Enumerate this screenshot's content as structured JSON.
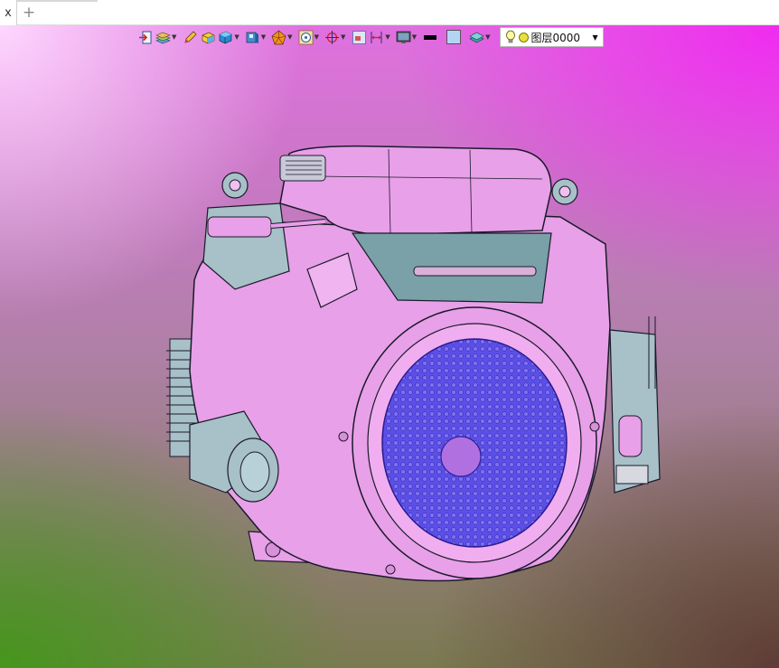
{
  "tabs": {
    "active_tab_label": "x",
    "new_tab_label": "+"
  },
  "toolbar": {
    "buttons": [
      {
        "name": "exit-sketch-icon",
        "has_dropdown": false
      },
      {
        "name": "layer-manager-icon",
        "has_dropdown": true
      },
      {
        "name": "pencil-icon",
        "has_dropdown": false
      },
      {
        "name": "shade-box-icon",
        "has_dropdown": false
      },
      {
        "name": "solid-cube-icon",
        "has_dropdown": true
      },
      {
        "name": "view-cube-icon",
        "has_dropdown": true
      },
      {
        "name": "render-mode-icon",
        "has_dropdown": true
      },
      {
        "name": "snap-circle-icon",
        "has_dropdown": true
      },
      {
        "name": "origin-axis-icon",
        "has_dropdown": true
      },
      {
        "name": "select-frame-icon",
        "has_dropdown": false
      },
      {
        "name": "dimension-icon",
        "has_dropdown": true
      },
      {
        "name": "display-icon",
        "has_dropdown": true
      },
      {
        "name": "line-color-icon",
        "has_dropdown": false
      },
      {
        "name": "fill-color-icon",
        "has_dropdown": false
      },
      {
        "name": "layer-stack-icon",
        "has_dropdown": true
      }
    ],
    "layer_select": {
      "value": "图层0000"
    }
  },
  "colors": {
    "model_body": "#e8a0e8",
    "model_outline": "#2a102a",
    "grille": "#5a50e8",
    "metal_parts": "#9ec0c8"
  }
}
